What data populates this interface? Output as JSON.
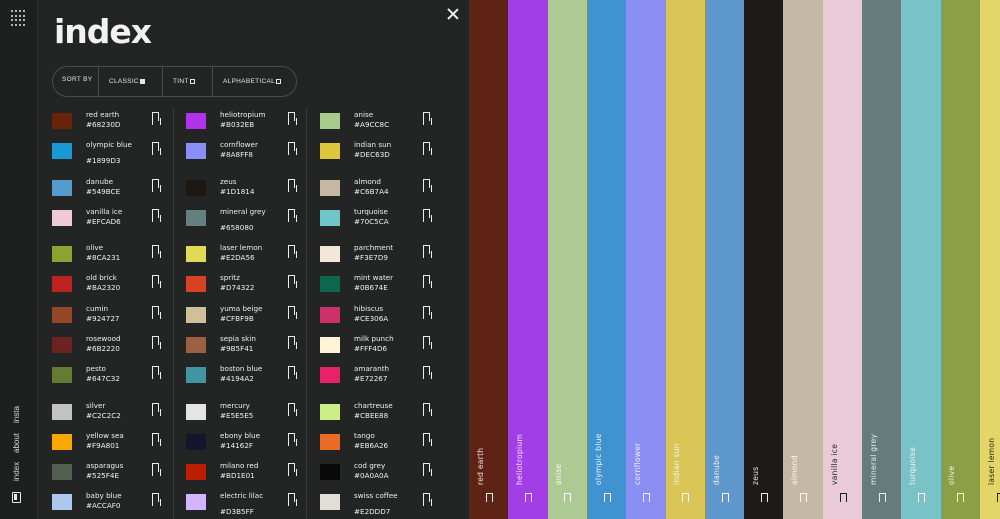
{
  "rail": {
    "nav": [
      "index",
      "about",
      "insta"
    ]
  },
  "panel": {
    "title": "index",
    "sort": {
      "label": "SORT BY",
      "options": [
        {
          "label": "CLASSIC",
          "selected": true
        },
        {
          "label": "TINT",
          "selected": false
        },
        {
          "label": "ALPHABETICAL",
          "selected": false
        }
      ]
    }
  },
  "columns": [
    [
      {
        "name": "red earth",
        "hex": "#68230D"
      },
      {
        "name": "olympic blue",
        "hex": "#1899D3"
      },
      {
        "name": "danube",
        "hex": "#549BCE"
      },
      {
        "name": "vanilla ice",
        "hex": "#EFCAD6"
      },
      {
        "name": "olive",
        "hex": "#8CA231"
      },
      {
        "name": "old brick",
        "hex": "#BA2320"
      },
      {
        "name": "cumin",
        "hex": "#924727"
      },
      {
        "name": "rosewood",
        "hex": "#6B2220"
      },
      {
        "name": "pesto",
        "hex": "#647C32"
      },
      {
        "name": "silver",
        "hex": "#C2C2C2"
      },
      {
        "name": "yellow sea",
        "hex": "#F9A801"
      },
      {
        "name": "asparagus",
        "hex": "#525F4E"
      },
      {
        "name": "baby blue",
        "hex": "#ACCAF0"
      }
    ],
    [
      {
        "name": "heliotropium",
        "hex": "#B032EB"
      },
      {
        "name": "cornflower",
        "hex": "#8A8FF8"
      },
      {
        "name": "zeus",
        "hex": "#1D1814"
      },
      {
        "name": "mineral grey",
        "hex": "#658080"
      },
      {
        "name": "laser lemon",
        "hex": "#E2DA56"
      },
      {
        "name": "spritz",
        "hex": "#D74322"
      },
      {
        "name": "yuma beige",
        "hex": "#CFBF9B"
      },
      {
        "name": "sepia skin",
        "hex": "#9B5F41"
      },
      {
        "name": "boston blue",
        "hex": "#4194A2"
      },
      {
        "name": "mercury",
        "hex": "#E5E5E5"
      },
      {
        "name": "ebony blue",
        "hex": "#14162F"
      },
      {
        "name": "milano red",
        "hex": "#BD1E01"
      },
      {
        "name": "electric lilac",
        "hex": "#D3B5FF"
      }
    ],
    [
      {
        "name": "anise",
        "hex": "#A9CC8C"
      },
      {
        "name": "indian sun",
        "hex": "#DEC63D"
      },
      {
        "name": "almond",
        "hex": "#C6B7A4"
      },
      {
        "name": "turquoise",
        "hex": "#70C5CA"
      },
      {
        "name": "parchment",
        "hex": "#F3E7D9"
      },
      {
        "name": "mint water",
        "hex": "#0B674E"
      },
      {
        "name": "hibiscus",
        "hex": "#CE306A"
      },
      {
        "name": "milk punch",
        "hex": "#FFF4D6"
      },
      {
        "name": "amaranth",
        "hex": "#E72267"
      },
      {
        "name": "chartreuse",
        "hex": "#CBEE88"
      },
      {
        "name": "tango",
        "hex": "#EB6A26"
      },
      {
        "name": "cod grey",
        "hex": "#0A0A0A"
      },
      {
        "name": "swiss coffee",
        "hex": "#E2DDD7"
      }
    ]
  ],
  "stripes": [
    {
      "name": "red earth",
      "color": "#5E2314",
      "text": "#f0e6e0"
    },
    {
      "name": "heliotropium",
      "color": "#A23EE6",
      "text": "#f4eafc"
    },
    {
      "name": "anise",
      "color": "#AECA93",
      "text": "#f6fbf2"
    },
    {
      "name": "olympic blue",
      "color": "#3F93D0",
      "text": "#eaf4fc"
    },
    {
      "name": "cornflower",
      "color": "#8B8FF3",
      "text": "#f0f0ff"
    },
    {
      "name": "indian sun",
      "color": "#DAC557",
      "text": "#fbf6de"
    },
    {
      "name": "danube",
      "color": "#5E98CC",
      "text": "#edf4fb"
    },
    {
      "name": "zeus",
      "color": "#1D1A17",
      "text": "#ececec"
    },
    {
      "name": "almond",
      "color": "#C5B8A5",
      "text": "#faf7f2"
    },
    {
      "name": "vanilla ice",
      "color": "#EACAD6",
      "text": "#1f1f1f"
    },
    {
      "name": "mineral grey",
      "color": "#647C7C",
      "text": "#e9efef"
    },
    {
      "name": "turquoise",
      "color": "#78C2C8",
      "text": "#eefafb"
    },
    {
      "name": "olive",
      "color": "#8C9F46",
      "text": "#f3f7e4"
    },
    {
      "name": "laser lemon",
      "color": "#E1D667",
      "text": "#1f1f1f"
    }
  ]
}
